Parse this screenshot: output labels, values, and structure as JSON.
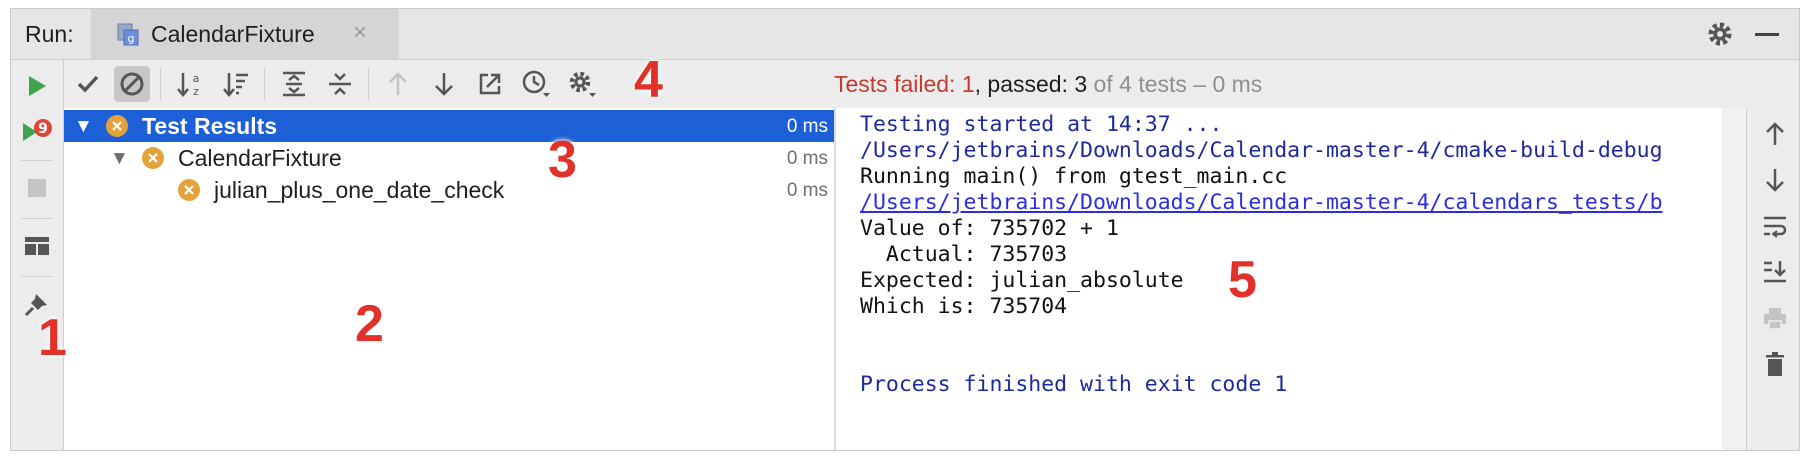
{
  "window": {
    "run_label": "Run:"
  },
  "tab": {
    "label": "CalendarFixture",
    "close": "×"
  },
  "toolbar_left": [
    "rerun-icon",
    "rerun-failed-icon",
    "stop-icon",
    "layout-icon",
    "pin-icon"
  ],
  "toolbar_top": [
    "show-passed-icon",
    "show-ignored-icon",
    "sort-alphabetically-icon",
    "sort-by-duration-icon",
    "expand-all-icon",
    "collapse-all-icon",
    "previous-failed-icon",
    "next-failed-icon",
    "export-icon",
    "history-icon",
    "settings-icon"
  ],
  "status": {
    "failed_label": "Tests failed: ",
    "failed_count": "1",
    "passed_label": ", passed: ",
    "passed_count": "3",
    "total": " of 4 tests",
    "duration": " – 0 ms"
  },
  "tree": {
    "rows": [
      {
        "label": "Test Results",
        "time": "0 ms",
        "status": "failed",
        "expanded": true,
        "selected": true
      },
      {
        "label": "CalendarFixture",
        "time": "0 ms",
        "status": "failed",
        "expanded": true,
        "selected": false
      },
      {
        "label": "julian_plus_one_date_check",
        "time": "0 ms",
        "status": "failed",
        "expanded": false,
        "selected": false
      }
    ]
  },
  "console": {
    "lines": [
      {
        "text": "Testing started at 14:37 ...",
        "style": "blue"
      },
      {
        "text": "/Users/jetbrains/Downloads/Calendar-master-4/cmake-build-debug",
        "style": "blue"
      },
      {
        "text": "Running main() from gtest_main.cc",
        "style": "black"
      },
      {
        "text": "/Users/jetbrains/Downloads/Calendar-master-4/calendars_tests/b",
        "style": "link"
      },
      {
        "text": "Value of: 735702 + 1",
        "style": "black"
      },
      {
        "text": "  Actual: 735703",
        "style": "black"
      },
      {
        "text": "Expected: julian_absolute",
        "style": "black"
      },
      {
        "text": "Which is: 735704",
        "style": "black"
      },
      {
        "text": "Process finished with exit code 1",
        "style": "blue"
      }
    ]
  },
  "toolbar_right": [
    "up-icon",
    "down-icon",
    "soft-wrap-icon",
    "scroll-to-end-icon",
    "print-icon",
    "clear-all-icon"
  ],
  "annotations": [
    "1",
    "2",
    "3",
    "4",
    "5"
  ],
  "colors": {
    "selection": "#1c5fd6",
    "failed": "#c33a2f",
    "status_icon": "#e3a23a",
    "console_blue": "#1d2a9c",
    "annotation": "#e2312a"
  }
}
